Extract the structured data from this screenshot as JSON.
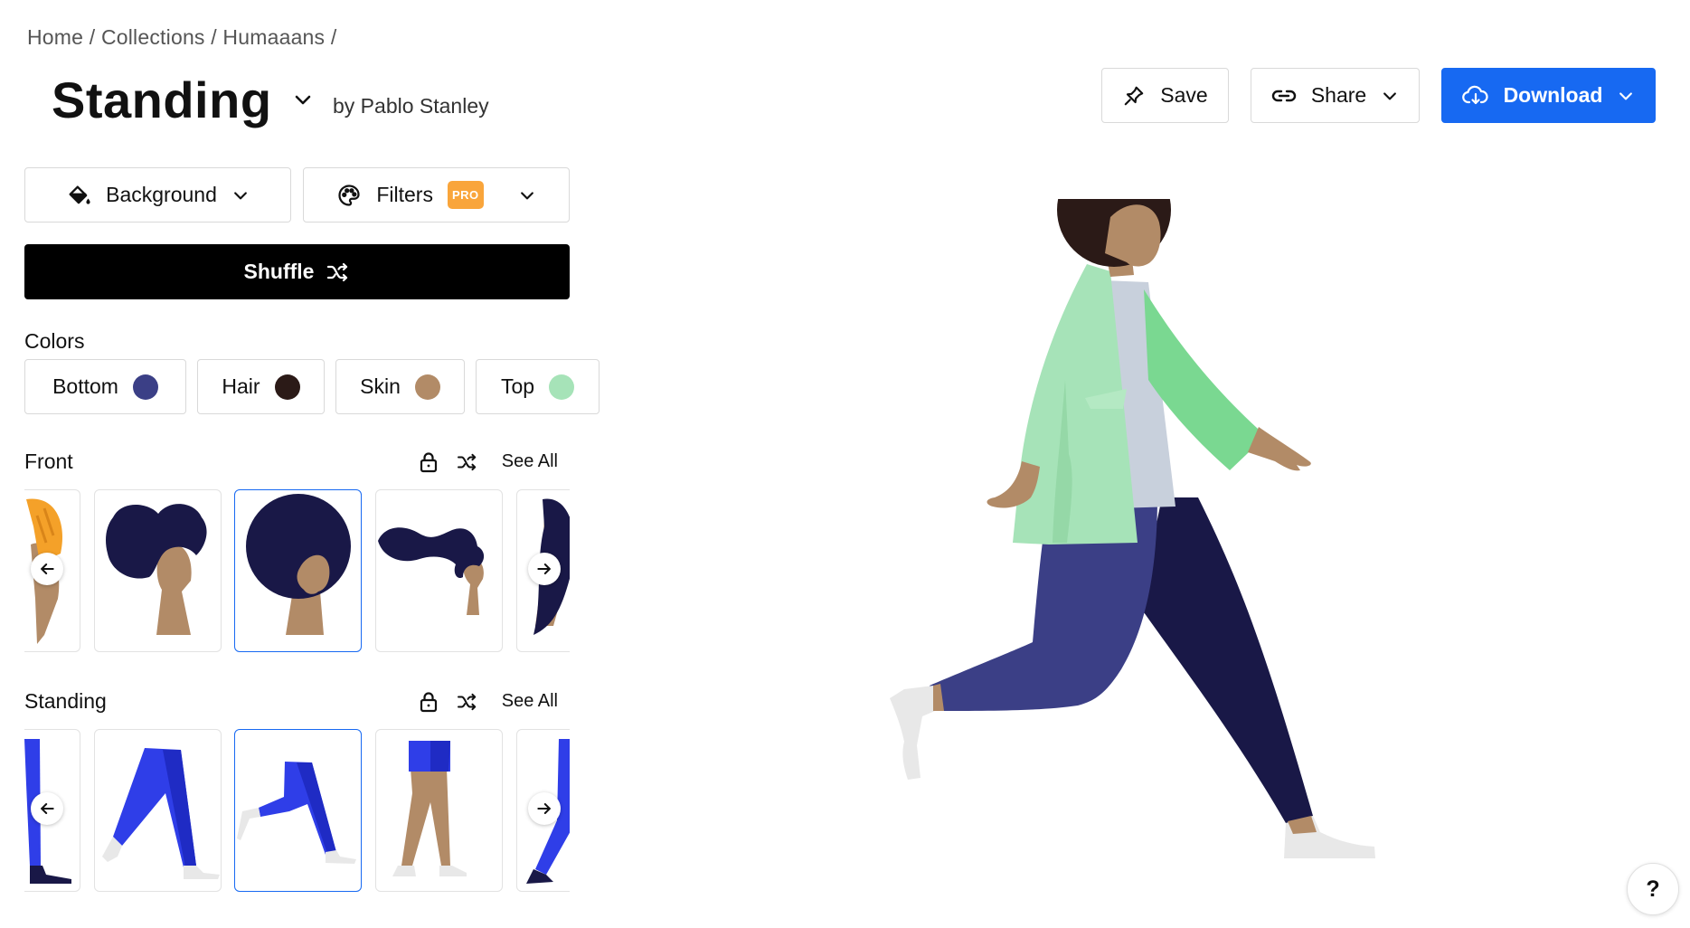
{
  "breadcrumb": {
    "home": "Home",
    "collections": "Collections",
    "pack": "Humaaans",
    "sep": "/"
  },
  "title": "Standing",
  "author": "by Pablo Stanley",
  "actions": {
    "save": "Save",
    "share": "Share",
    "download": "Download"
  },
  "options": {
    "background": "Background",
    "filters": "Filters",
    "pro_badge": "PRO"
  },
  "shuffle": "Shuffle",
  "colors": {
    "label": "Colors",
    "chips": [
      {
        "label": "Bottom",
        "color": "#3b3f86"
      },
      {
        "label": "Hair",
        "color": "#2b1a17"
      },
      {
        "label": "Skin",
        "color": "#b28b67"
      },
      {
        "label": "Top",
        "color": "#a6e3b8"
      }
    ]
  },
  "sections": [
    {
      "name": "Front",
      "see_all": "See All"
    },
    {
      "name": "Standing",
      "see_all": "See All"
    }
  ],
  "palette": {
    "accent": "#1769f2",
    "pro": "#f9a53b",
    "skin": "#b28b67",
    "hair_dark": "#191847",
    "hair_preview_orange": "#f4a129",
    "pants_blue": "#2f3ee8",
    "pants_main": "#3b3f86",
    "pants_dark": "#191847",
    "jacket": "#a6e3b8",
    "jacket_dark": "#7ad891",
    "shirt": "#c8d0dc",
    "shoe": "#e8e8e8"
  },
  "help": "?"
}
